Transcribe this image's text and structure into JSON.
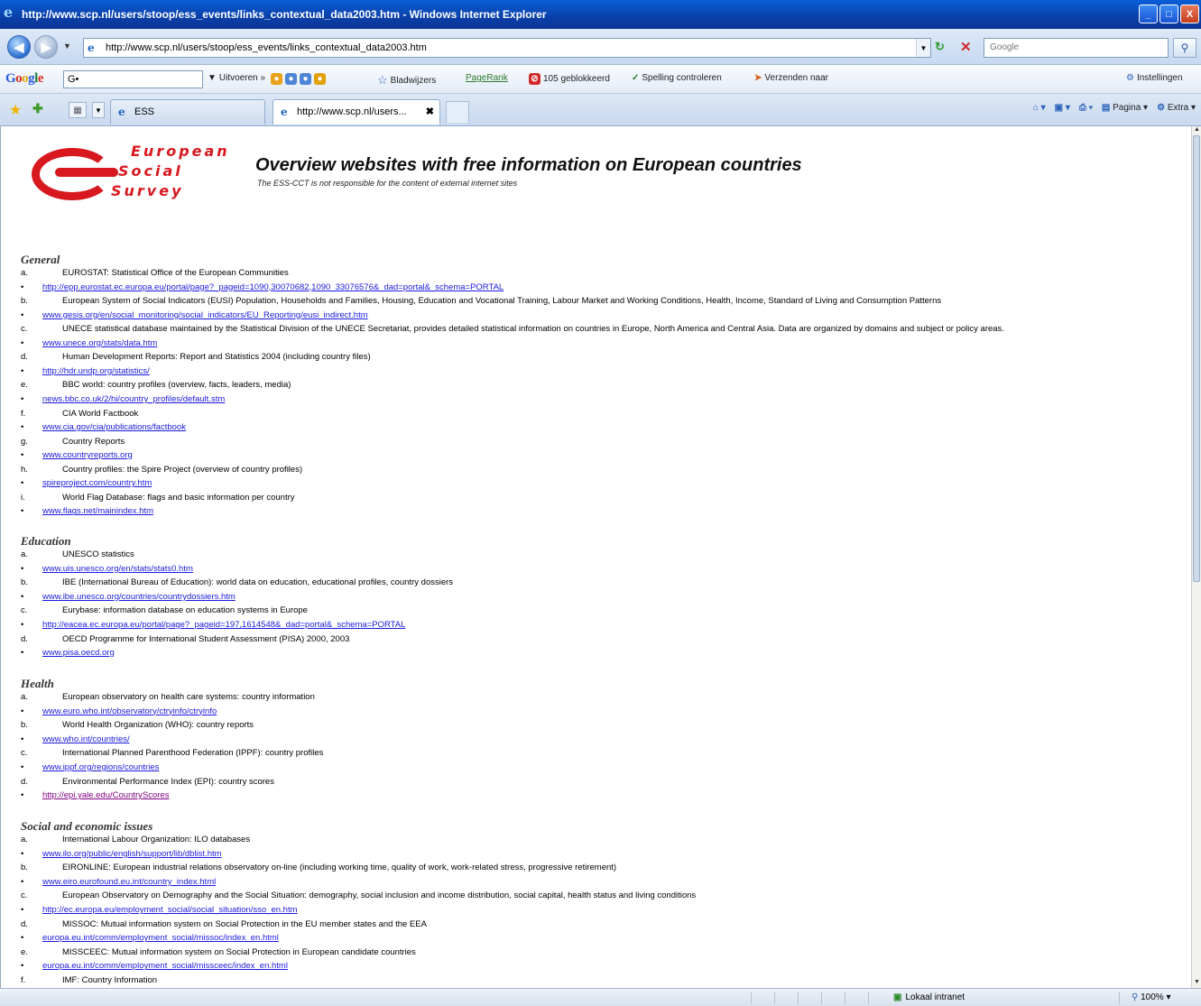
{
  "window": {
    "title": "http://www.scp.nl/users/stoop/ess_events/links_contextual_data2003.htm - Windows Internet Explorer",
    "minimize": "_",
    "maximize": "□",
    "close": "X"
  },
  "address": {
    "url": "http://www.scp.nl/users/stoop/ess_events/links_contextual_data2003.htm",
    "search_placeholder": "Google"
  },
  "google_toolbar": {
    "logo_letters": [
      "G",
      "o",
      "o",
      "g",
      "l",
      "e"
    ],
    "search_value": "G•",
    "items": {
      "uitvoeren": "Uitvoeren »",
      "bladwijzers": "Bladwijzers",
      "pagerank": "PageRank",
      "geblokkeerd": "105 geblokkeerd",
      "spelling": "Spelling controleren",
      "verzenden": "Verzenden naar",
      "instellingen": "Instellingen"
    }
  },
  "tabs": {
    "tab1": "ESS",
    "tab2": "http://www.scp.nl/users...",
    "commands": {
      "pagina": "Pagina",
      "extra": "Extra"
    }
  },
  "page": {
    "logo_words": [
      "European",
      "Social",
      "Survey"
    ],
    "title": "Overview websites with free information on European countries",
    "subtitle": "The ESS-CCT is not responsible for the content of external internet sites",
    "sections": [
      {
        "heading": "General",
        "lines": [
          {
            "m": "a.",
            "t": "EUROSTAT: Statistical Office of the European Communities",
            "link": false
          },
          {
            "m": "•",
            "t": "http://epp.eurostat.ec.europa.eu/portal/page?_pageid=1090,30070682,1090_33076576&_dad=portal&_schema=PORTAL",
            "link": true
          },
          {
            "m": "b.",
            "t": "European System of Social Indicators (EUSI) Population, Households and Families, Housing, Education and Vocational Training, Labour Market and Working Conditions, Health, Income, Standard of Living and Consumption Patterns",
            "link": false
          },
          {
            "m": "•",
            "t": "www.gesis.org/en/social_monitoring/social_indicators/EU_Reporting/eusi_indirect.htm",
            "link": true
          },
          {
            "m": "c.",
            "t": "UNECE statistical database maintained by the Statistical Division of the UNECE Secretariat, provides detailed statistical information on countries in Europe, North America and Central Asia. Data are organized by domains and subject or policy areas.",
            "link": false
          },
          {
            "m": "•",
            "t": "www.unece.org/stats/data.htm",
            "link": true
          },
          {
            "m": "d.",
            "t": "Human Development Reports: Report and Statistics 2004 (including country files)",
            "link": false
          },
          {
            "m": "•",
            "t": "http://hdr.undp.org/statistics/",
            "link": true
          },
          {
            "m": "e.",
            "t": "BBC world: country profiles (overview, facts, leaders, media)",
            "link": false
          },
          {
            "m": "•",
            "t": "news.bbc.co.uk/2/hi/country_profiles/default.stm",
            "link": true
          },
          {
            "m": "f.",
            "t": "CIA World Factbook",
            "link": false
          },
          {
            "m": "•",
            "t": "www.cia.gov/cia/publications/factbook",
            "link": true
          },
          {
            "m": "g.",
            "t": "Country Reports",
            "link": false
          },
          {
            "m": "•",
            "t": "www.countryreports.org",
            "link": true
          },
          {
            "m": "h.",
            "t": "Country profiles: the Spire Project (overview of country profiles)",
            "link": false
          },
          {
            "m": "•",
            "t": "spireproject.com/country.htm",
            "link": true
          },
          {
            "m": "i.",
            "t": "World Flag Database: flags and basic information per country",
            "link": false
          },
          {
            "m": "•",
            "t": "www.flags.net/mainindex.htm",
            "link": true
          }
        ]
      },
      {
        "heading": "Education",
        "lines": [
          {
            "m": "a.",
            "t": "UNESCO statistics",
            "link": false
          },
          {
            "m": "•",
            "t": "www.uis.unesco.org/en/stats/stats0.htm",
            "link": true
          },
          {
            "m": "b.",
            "t": "IBE (International Bureau of Education): world data on education, educational profiles, country dossiers",
            "link": false
          },
          {
            "m": "•",
            "t": "www.ibe.unesco.org/countries/countrydossiers.htm",
            "link": true
          },
          {
            "m": "c.",
            "t": "Eurybase: information database on education systems in Europe",
            "link": false
          },
          {
            "m": "•",
            "t": "http://eacea.ec.europa.eu/portal/page?_pageid=197,1614548&_dad=portal&_schema=PORTAL",
            "link": true
          },
          {
            "m": "d.",
            "t": "OECD Programme for International Student Assessment (PISA) 2000, 2003",
            "link": false
          },
          {
            "m": "•",
            "t": "www.pisa.oecd.org",
            "link": true
          }
        ]
      },
      {
        "heading": "Health",
        "lines": [
          {
            "m": "a.",
            "t": "European observatory on health care systems: country information",
            "link": false
          },
          {
            "m": "•",
            "t": "www.euro.who.int/observatory/ctryinfo/ctryinfo",
            "link": true
          },
          {
            "m": "b.",
            "t": "World Health Organization (WHO): country reports",
            "link": false
          },
          {
            "m": "•",
            "t": "www.who.int/countries/",
            "link": true
          },
          {
            "m": "c.",
            "t": "International Planned Parenthood Federation (IPPF): country profiles",
            "link": false
          },
          {
            "m": "•",
            "t": "www.ippf.org/regions/countries",
            "link": true
          },
          {
            "m": "d.",
            "t": "Environmental Performance Index (EPI): country scores",
            "link": false
          },
          {
            "m": "•",
            "t": "http://epi.yale.edu/CountryScores",
            "link": true,
            "visited": true
          }
        ]
      },
      {
        "heading": "Social and economic  issues",
        "lines": [
          {
            "m": "a.",
            "t": "International Labour Organization: ILO databases",
            "link": false
          },
          {
            "m": "•",
            "t": "www.ilo.org/public/english/support/lib/dblist.htm",
            "link": true
          },
          {
            "m": "b.",
            "t": "EIRONLINE: European industrial relations observatory on-line (including working time, quality of work, work-related stress, progressive retirement)",
            "link": false
          },
          {
            "m": "•",
            "t": "www.eiro.eurofound.eu.int/country_index.html",
            "link": true
          },
          {
            "m": "c.",
            "t": "European Observatory on Demography and the Social Situation: demography, social inclusion and income distribution, social capital, health status and living conditions",
            "link": false
          },
          {
            "m": "•",
            "t": "http://ec.europa.eu/employment_social/social_situation/sso_en.htm",
            "link": true
          },
          {
            "m": "d.",
            "t": "MISSOC: Mutual information system on Social Protection in the EU member states and the EEA",
            "link": false
          },
          {
            "m": "•",
            "t": "europa.eu.int/comm/employment_social/missoc/index_en.html",
            "link": true
          },
          {
            "m": "e.",
            "t": "MISSCEEC: Mutual information system on Social Protection in European candidate countries",
            "link": false
          },
          {
            "m": "•",
            "t": "europa.eu.int/comm/employment_social/missceec/index_en.html",
            "link": true
          },
          {
            "m": "f.",
            "t": "IMF: Country Information",
            "link": false
          }
        ]
      }
    ]
  },
  "status": {
    "zone": "Lokaal intranet",
    "zoom": "100%"
  }
}
